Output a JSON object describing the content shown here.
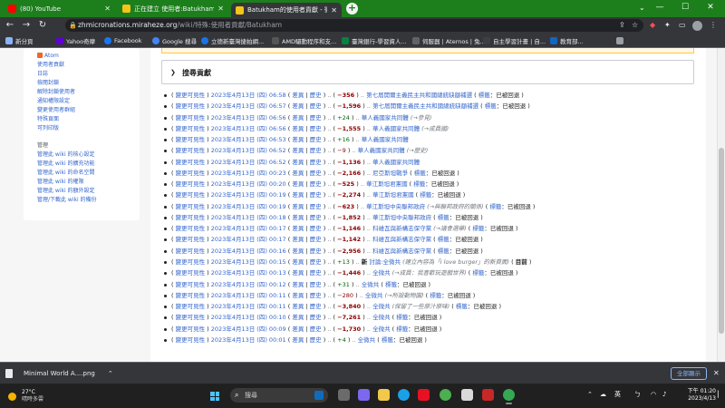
{
  "browser": {
    "tabs": [
      {
        "title": "(80) YouTube",
        "favicon": "youtube-icon",
        "color": "#ff0000"
      },
      {
        "title": "正在建立 使用者:Batukham - 欣...",
        "favicon": "wiki-icon",
        "color": "#f5c518"
      },
      {
        "title": "Batukham的使用者貢獻 - 微娜...",
        "favicon": "wiki-icon",
        "color": "#f5c518",
        "active": true
      }
    ],
    "window_controls": {
      "minimize": "—",
      "maximize": "☐",
      "close": "✕"
    },
    "address_host": "zhmicronations.miraheze.org",
    "address_path": "/wiki/特殊:使用者貢獻/Batukham",
    "bookmarks": [
      {
        "label": "新分頁",
        "color": "#8ab4f8"
      },
      {
        "label": "Yahoo奇摩",
        "color": "#6001d2"
      },
      {
        "label": "Facebook",
        "color": "#1877f2"
      },
      {
        "label": "Google 搜尋",
        "color": "#4285f4"
      },
      {
        "label": "立德新臺灣捷拍網...",
        "color": "#1a73e8"
      },
      {
        "label": "AMD驅動程序和支...",
        "color": "#555555"
      },
      {
        "label": "臺灣銀行-學習資人...",
        "color": "#0b8043"
      },
      {
        "label": "伺服器 | Aternos | 兔...",
        "color": "#5f6368"
      },
      {
        "label": "自主學習計畫 | 自...",
        "color": "#3c4043"
      },
      {
        "label": "教育部...",
        "color": "#1565c0"
      }
    ]
  },
  "sidebar": {
    "links_top": [
      "Atom",
      "使用者貢獻",
      "日誌",
      "檢閱封鎖",
      "解除封鎖使用者",
      "通知權限設定",
      "變更使用者群組",
      "特殊頁面",
      "可列印版"
    ],
    "admin_heading": "管理",
    "links_admin": [
      "管理此 wiki 的核心設定",
      "管理此 wiki 的擴充功能",
      "管理此 wiki 的命名空間",
      "管理此 wiki 的權限",
      "管理此 wiki 的額外設定",
      "管理/下載此 wiki 的備份"
    ]
  },
  "section": {
    "title": "搜尋貢獻"
  },
  "labels": {
    "changes": "變更可見性",
    "diff": "差異",
    "hist": "歷史",
    "sep": "..",
    "pipe": "|",
    "tags_label": "標籤",
    "tag_reverted": "已被回退",
    "current": "目前",
    "new": "新"
  },
  "contributions": [
    {
      "date": "2023年4月13日 (四) 06:58",
      "size": "−356",
      "sizeType": "neg",
      "page": "第七屆開爾主義民主共和國總統缺額補選",
      "comment": "",
      "tags": true
    },
    {
      "date": "2023年4月13日 (四) 06:57",
      "size": "−1,596",
      "sizeType": "neg",
      "page": "第七屆開爾主義民主共和國總統缺額補選",
      "comment": "",
      "tags": true
    },
    {
      "date": "2023年4月13日 (四) 06:56",
      "size": "+24",
      "sizeType": "pos",
      "page": "華人義國家共同體",
      "comment": "(→參見)",
      "tags": false
    },
    {
      "date": "2023年4月13日 (四) 06:56",
      "size": "−1,555",
      "sizeType": "neg",
      "page": "華人義國家共同體",
      "comment": "(→成員國)",
      "tags": false
    },
    {
      "date": "2023年4月13日 (四) 06:53",
      "size": "+16",
      "sizeType": "pos",
      "page": "華人義國家共同體",
      "comment": "",
      "tags": false
    },
    {
      "date": "2023年4月13日 (四) 06:52",
      "size": "−9",
      "sizeType": "negs",
      "page": "華人義國家共同體",
      "comment": "(→歷史)",
      "tags": false
    },
    {
      "date": "2023年4月13日 (四) 06:52",
      "size": "−1,136",
      "sizeType": "neg",
      "page": "華人義國家共同體",
      "comment": "",
      "tags": false
    },
    {
      "date": "2023年4月13日 (四) 00:23",
      "size": "−2,166",
      "sizeType": "neg",
      "page": "尼亞斯坦戰爭",
      "comment": "",
      "tags": true
    },
    {
      "date": "2023年4月13日 (四) 00:20",
      "size": "−525",
      "sizeType": "neg",
      "page": "華江斯坦君憲國",
      "comment": "",
      "tags": true
    },
    {
      "date": "2023年4月13日 (四) 00:19",
      "size": "−2,274",
      "sizeType": "neg",
      "page": "華江斯坦君憲國",
      "comment": "",
      "tags": true
    },
    {
      "date": "2023年4月13日 (四) 00:19",
      "size": "−623",
      "sizeType": "neg",
      "page": "華江斯坦中央聯邦政府",
      "comment": "(→與聯邦政府的關係)",
      "tags": true
    },
    {
      "date": "2023年4月13日 (四) 00:18",
      "size": "−1,852",
      "sizeType": "neg",
      "page": "華江斯坦中央聯邦政府",
      "comment": "",
      "tags": true
    },
    {
      "date": "2023年4月13日 (四) 00:17",
      "size": "−1,146",
      "sizeType": "neg",
      "page": "科維瓦與新構志保守黨",
      "comment": "(→議會選舉)",
      "tags": true
    },
    {
      "date": "2023年4月13日 (四) 00:17",
      "size": "−1,142",
      "sizeType": "neg",
      "page": "科維瓦與新構志保守黨",
      "comment": "",
      "tags": true
    },
    {
      "date": "2023年4月13日 (四) 00:16",
      "size": "−2,956",
      "sizeType": "neg",
      "page": "科維瓦與新構志保守黨",
      "comment": "",
      "tags": true
    },
    {
      "date": "2023年4月13日 (四) 00:15",
      "size": "+13",
      "sizeType": "pos",
      "page": "討論:全微共",
      "comment": "(建立內容為「I love burger」的新頁面)",
      "tags": false,
      "isNew": true,
      "isCurrent": true
    },
    {
      "date": "2023年4月13日 (四) 00:13",
      "size": "−1,446",
      "sizeType": "neg",
      "page": "全微共",
      "comment": "(→成員：我喜歡玩遊戲世界)",
      "tags": true
    },
    {
      "date": "2023年4月13日 (四) 00:12",
      "size": "+31",
      "sizeType": "pos",
      "page": "全微共",
      "comment": "",
      "tags": true
    },
    {
      "date": "2023年4月13日 (四) 00:11",
      "size": "−280",
      "sizeType": "negs",
      "page": "全微共",
      "comment": "(→所設動物園)",
      "tags": true
    },
    {
      "date": "2023年4月13日 (四) 00:11",
      "size": "−3,840",
      "sizeType": "neg",
      "page": "全微共",
      "comment": "(保留了一些原汁原味)",
      "tags": true
    },
    {
      "date": "2023年4月13日 (四) 00:10",
      "size": "−7,261",
      "sizeType": "neg",
      "page": "全微共",
      "comment": "",
      "tags": true
    },
    {
      "date": "2023年4月13日 (四) 00:09",
      "size": "−1,730",
      "sizeType": "neg",
      "page": "全微共",
      "comment": "",
      "tags": true
    },
    {
      "date": "2023年4月13日 (四) 00:01",
      "size": "+4",
      "sizeType": "pos",
      "page": "全微共",
      "comment": "",
      "tags": true
    }
  ],
  "download": {
    "file": "Minimal World A....png",
    "show_all": "全部顯示"
  },
  "taskbar": {
    "temp": "27°C",
    "weather": "晴時多雲",
    "search_placeholder": "搜尋",
    "lang": "英",
    "time": "下午 01:20",
    "date": "2023/4/13"
  }
}
